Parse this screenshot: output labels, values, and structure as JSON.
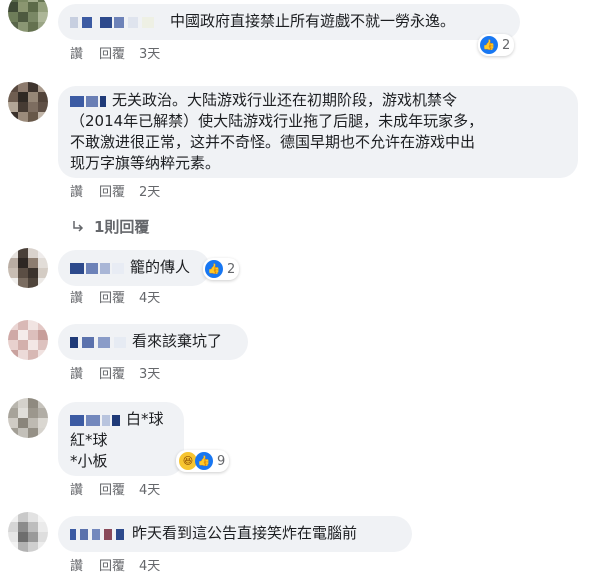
{
  "comments": [
    {
      "text": "中國政府直接禁止所有遊戲不就一勞永逸。",
      "like_label": "讚",
      "reply_label": "回覆",
      "time": "3天",
      "reactions": {
        "count": "2",
        "icons": [
          "like"
        ]
      }
    },
    {
      "text": "无关政治。大陆游戏行业还在初期阶段，游戏机禁令\n（2014年已解禁）使大陆游戏行业拖了后腿，未成年玩家多，\n不敢激进很正常，这并不奇怪。德国早期也不允许在游戏中出\n现万字旗等纳粹元素。",
      "like_label": "讚",
      "reply_label": "回覆",
      "time": "2天",
      "replies_label": "1則回覆"
    },
    {
      "text": "籠的傳人",
      "like_label": "讚",
      "reply_label": "回覆",
      "time": "4天",
      "reactions": {
        "count": "2",
        "icons": [
          "like"
        ]
      }
    },
    {
      "text": "看來該棄坑了",
      "like_label": "讚",
      "reply_label": "回覆",
      "time": "3天"
    },
    {
      "text": "白*球\n紅*球\n*小板",
      "like_label": "讚",
      "reply_label": "回覆",
      "time": "4天",
      "reactions": {
        "count": "9",
        "icons": [
          "haha",
          "like"
        ]
      }
    },
    {
      "text": "昨天看到這公告直接笑炸在電腦前",
      "like_label": "讚",
      "reply_label": "回覆",
      "time": "4天"
    }
  ],
  "colors": {
    "bubble": "#f0f2f5",
    "meta": "#65676b",
    "like": "#1877f2",
    "haha": "#f7c531"
  },
  "icons": {
    "like": "thumbs-up-icon",
    "haha": "laughing-face-icon",
    "reply_arrow": "reply-arrow-icon"
  }
}
